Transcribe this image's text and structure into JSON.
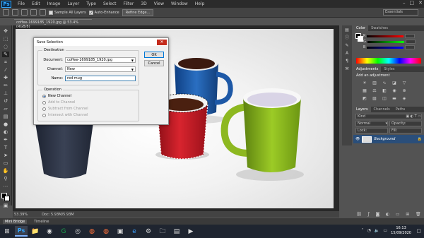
{
  "app": {
    "logo": "Ps"
  },
  "menu": [
    "File",
    "Edit",
    "Image",
    "Layer",
    "Type",
    "Select",
    "Filter",
    "3D",
    "View",
    "Window",
    "Help"
  ],
  "window_controls": [
    "–",
    "□",
    "✕"
  ],
  "options_bar": {
    "sample_all_layers": "Sample All Layers",
    "auto_enhance": "Auto-Enhance",
    "refine_edge": "Refine Edge...",
    "workspace": "Essentials"
  },
  "document_tab": "coffee-1699185_1920.jpg @ 53.4% (RGB/8)",
  "status": {
    "zoom": "53.39%",
    "doc_size": "Doc: 5.93M/5.93M"
  },
  "mini_bridge": {
    "tabs": [
      "Mini Bridge",
      "Timeline"
    ]
  },
  "dialog": {
    "title": "Save Selection",
    "close": "✕",
    "destination": {
      "title": "Destination",
      "document_label": "Document:",
      "document_value": "coffee-1699185_1920.jpg",
      "channel_label": "Channel:",
      "channel_value": "New",
      "name_label": "Name:",
      "name_value": "red mug"
    },
    "operation": {
      "title": "Operation",
      "options": [
        "New Channel",
        "Add to Channel",
        "Subtract from Channel",
        "Intersect with Channel"
      ],
      "selected": 0
    },
    "ok": "OK",
    "cancel": "Cancel"
  },
  "panels": {
    "color_tabs": [
      "Color",
      "Swatches"
    ],
    "rgb": [
      "R",
      "G",
      "B"
    ],
    "adjustments_tabs": [
      "Adjustments",
      "Styles"
    ],
    "adjustments_hint": "Add an adjustment",
    "layers_tabs": [
      "Layers",
      "Channels",
      "Paths"
    ],
    "kind": "Kind",
    "blend_mode": "Normal",
    "opacity": "Opacity:",
    "lock": "Lock:",
    "fill": "Fill:",
    "layer_name": "Background"
  },
  "taskbar": {
    "time": "16:13",
    "date": "15/09/2020"
  },
  "colors": {
    "ps_blue": "#31a8ff",
    "layer_selected": "#2a4e7a",
    "mug_blue": "#1e5aa8",
    "mug_red": "#c8202a",
    "mug_green": "#8cb81e",
    "mug_dark": "#2c3240"
  }
}
